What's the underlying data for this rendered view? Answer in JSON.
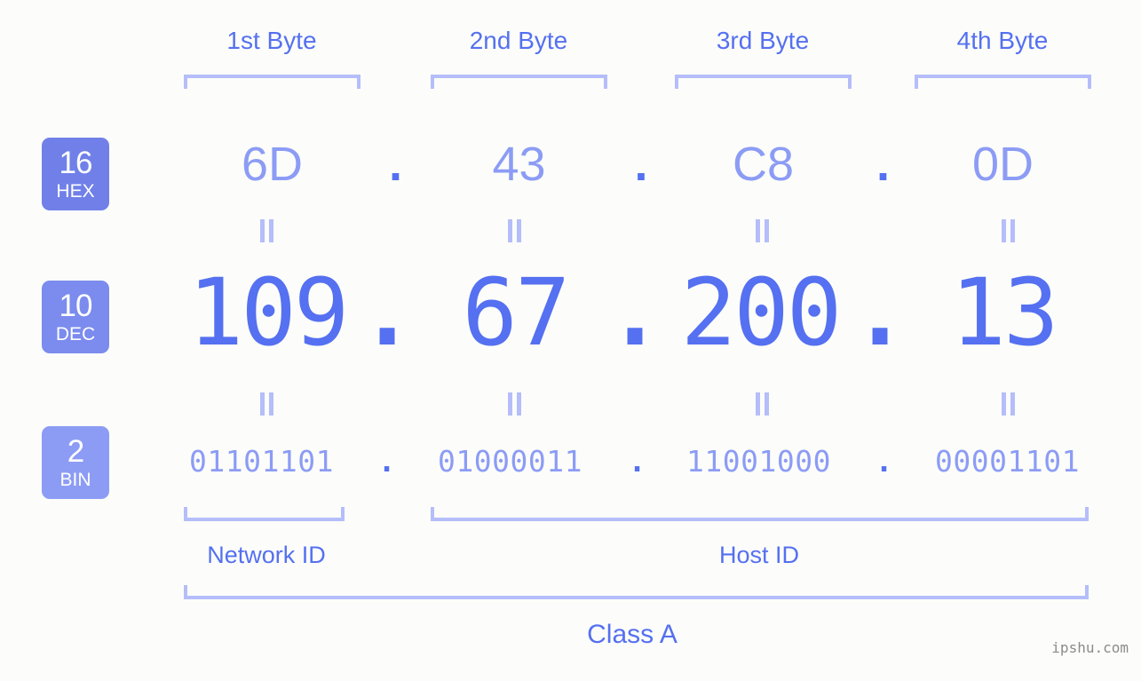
{
  "background_color": "#fcfdfa",
  "accent_color": "#5570f0",
  "accent_light_color": "#8c9cf5",
  "bracket_color": "#b5bdfa",
  "byte_headers": [
    {
      "label": "1st Byte"
    },
    {
      "label": "2nd Byte"
    },
    {
      "label": "3rd Byte"
    },
    {
      "label": "4th Byte"
    }
  ],
  "rows": {
    "hex": {
      "badge_number": "16",
      "badge_name": "HEX",
      "badge_color": "#7080e8",
      "values": [
        "6D",
        "43",
        "C8",
        "0D"
      ],
      "separator": "."
    },
    "dec": {
      "badge_number": "10",
      "badge_name": "DEC",
      "badge_color": "#7b8bee",
      "values": [
        "109",
        "67",
        "200",
        "13"
      ],
      "separator": "."
    },
    "bin": {
      "badge_number": "2",
      "badge_name": "BIN",
      "badge_color": "#8c9cf5",
      "values": [
        "01101101",
        "01000011",
        "11001000",
        "00001101"
      ],
      "separator": "."
    }
  },
  "equals_separator": "=",
  "regions": [
    {
      "label": "Network ID"
    },
    {
      "label": "Host ID"
    }
  ],
  "class_label": "Class A",
  "watermark": "ipshu.com"
}
